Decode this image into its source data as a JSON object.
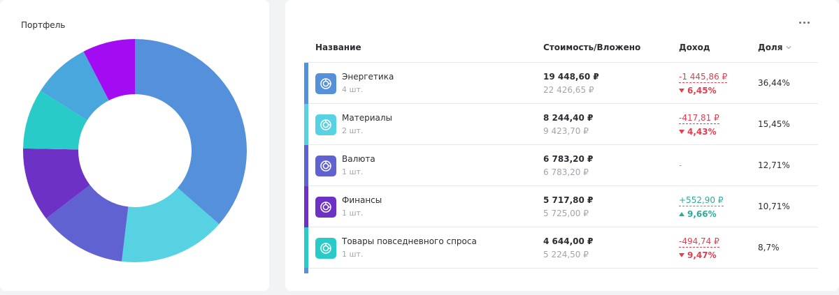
{
  "portfolio": {
    "title": "Портфель"
  },
  "table": {
    "headers": {
      "name": "Название",
      "value": "Стоимость/Вложено",
      "income": "Доход",
      "share": "Доля"
    },
    "sort_column": "share",
    "rows": [
      {
        "name": "Энергетика",
        "qty": "4 шт.",
        "value": "19 448,60 ₽",
        "invested": "22 426,65 ₽",
        "income": "-1 445,86 ₽",
        "income_pct": "6,45%",
        "trend": "down",
        "share": "36,44%",
        "color": "#5590db",
        "icon": "sector-icon"
      },
      {
        "name": "Материалы",
        "qty": "2 шт.",
        "value": "8 244,40 ₽",
        "invested": "9 423,70 ₽",
        "income": "-417,81 ₽",
        "income_pct": "4,43%",
        "trend": "down",
        "share": "15,45%",
        "color": "#56d2e2",
        "icon": "sector-icon"
      },
      {
        "name": "Валюта",
        "qty": "1 шт.",
        "value": "6 783,20 ₽",
        "invested": "6 783,20 ₽",
        "income": "-",
        "income_pct": "",
        "trend": "none",
        "share": "12,71%",
        "color": "#6162d2",
        "icon": "sector-icon"
      },
      {
        "name": "Финансы",
        "qty": "1 шт.",
        "value": "5 717,80 ₽",
        "invested": "5 725,00 ₽",
        "income": "+552,90 ₽",
        "income_pct": "9,66%",
        "trend": "up",
        "share": "10,71%",
        "color": "#6e31c6",
        "icon": "sector-icon"
      },
      {
        "name": "Товары повседневного спроса",
        "qty": "1 шт.",
        "value": "4 644,00 ₽",
        "invested": "5 224,50 ₽",
        "income": "-494,74 ₽",
        "income_pct": "9,47%",
        "trend": "down",
        "share": "8,7%",
        "color": "#28cbc8",
        "icon": "sector-icon"
      }
    ]
  },
  "chart_data": {
    "type": "pie",
    "title": "Портфель",
    "categories": [
      "Энергетика",
      "Материалы",
      "Валюта",
      "Финансы",
      "Товары повседневного спроса",
      "",
      ""
    ],
    "values": [
      36.44,
      15.45,
      12.71,
      10.71,
      8.7,
      8.4,
      7.59
    ],
    "colors": [
      "#5590db",
      "#56d2e2",
      "#6162d2",
      "#6e31c6",
      "#28cbc8",
      "#4aa7de",
      "#a30bf3"
    ]
  }
}
